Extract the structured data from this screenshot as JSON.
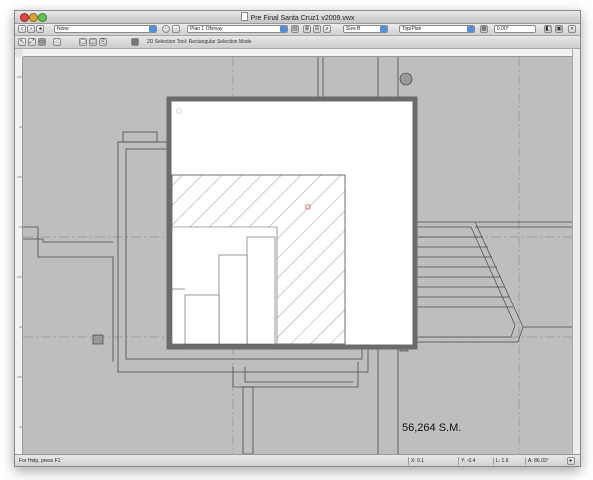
{
  "window": {
    "title": "Pre Final Santa Cruz1 v2009.vwx"
  },
  "toolbar1": {
    "class_select": "None",
    "layer_select": "Plan 1 Ofxinay",
    "scale_select": "Size B",
    "view_select": "Top/Plan",
    "zoom_field": "0.00°"
  },
  "toolbar2": {
    "tool_mode_text": "2D Selection Tool: Rectangular Selection Mode"
  },
  "drawing": {
    "area_label": "56,264  S.M."
  },
  "status": {
    "help_text": "For Help, press F1",
    "x_label": "X: 0.1",
    "y_label": "Y: -0.4",
    "l_label": "L: 1.6",
    "a_label": "A: 86.03°"
  },
  "colors": {
    "canvas_bg": "#bebebe",
    "window_chrome": "#d9d9d9",
    "accent_blue": "#4f8ee0",
    "selection_marker": "#e05050"
  },
  "icons": {
    "back": "arrow-left-icon",
    "forward": "arrow-right-icon",
    "flyover": "flyover-icon",
    "selection_tool": "selection-arrow-icon",
    "layer_options": "layer-options-icon",
    "view_options": "view-options-icon"
  }
}
